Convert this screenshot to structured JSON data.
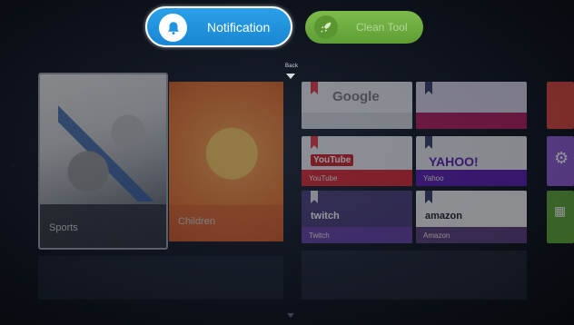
{
  "top_bar": {
    "notification_label": "Notification",
    "clean_tool_label": "Clean Tool"
  },
  "nav": {
    "back_label": "Back"
  },
  "tiles": {
    "sports_label": "Sports",
    "children_label": "Children"
  },
  "websites": [
    {
      "logo": "Google",
      "caption": ""
    },
    {
      "logo": "",
      "caption": ""
    },
    {
      "logo": "YouTube",
      "caption": "YouTube"
    },
    {
      "logo": "YAHOO!",
      "caption": "Yahoo"
    },
    {
      "logo": "twitch",
      "caption": "Twitch"
    },
    {
      "logo": "amazon",
      "caption": "Amazon"
    }
  ],
  "icons": {
    "notification": "bell-icon",
    "clean_tool": "rocket-icon",
    "settings": "gear-icon",
    "apps": "grid-icon"
  },
  "colors": {
    "notification_blue": "#1f93dd",
    "clean_green": "#6aa83d",
    "youtube_red": "#d8262f",
    "yahoo_purple": "#5a1db0",
    "twitch_purple": "#6441a4"
  }
}
